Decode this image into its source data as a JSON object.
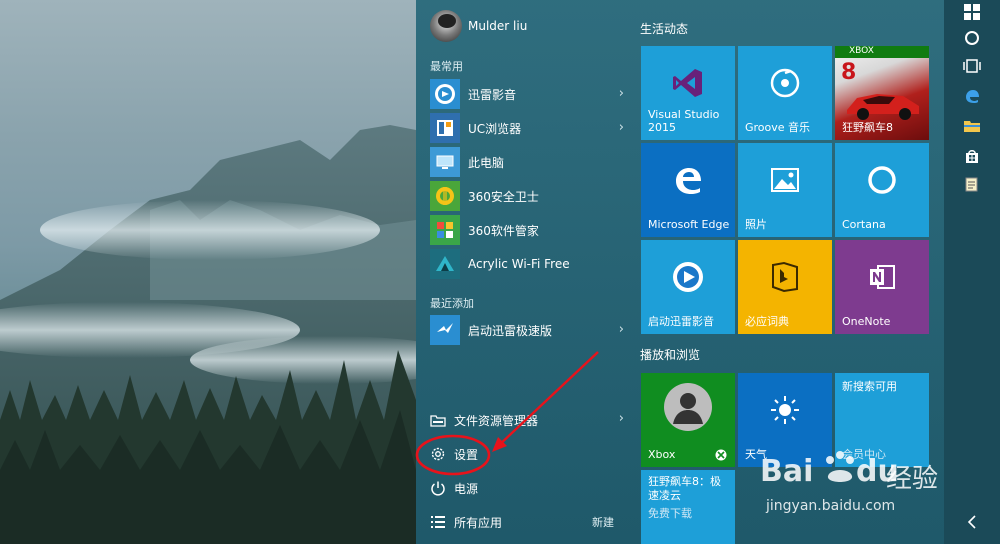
{
  "user": {
    "name": "Mulder liu"
  },
  "sections": {
    "most_used": "最常用",
    "recently_added": "最近添加"
  },
  "most_used_apps": [
    {
      "label": "迅雷影音",
      "has_arrow": true
    },
    {
      "label": "UC浏览器",
      "has_arrow": true
    },
    {
      "label": "此电脑",
      "has_arrow": false
    },
    {
      "label": "360安全卫士",
      "has_arrow": false
    },
    {
      "label": "360软件管家",
      "has_arrow": false
    },
    {
      "label": "Acrylic Wi-Fi Free",
      "has_arrow": false
    }
  ],
  "recent_apps": [
    {
      "label": "启动迅雷极速版",
      "has_arrow": true
    }
  ],
  "bottom": {
    "file_explorer": "文件资源管理器",
    "settings": "设置",
    "power": "电源",
    "all_apps": "所有应用",
    "new": "新建"
  },
  "tile_groups": {
    "life": "生活动态",
    "play": "播放和浏览"
  },
  "tiles": {
    "vs": "Visual Studio\n2015",
    "groove": "Groove 音乐",
    "racing": "狂野飙车8",
    "edge": "Microsoft Edge",
    "photos": "照片",
    "cortana": "Cortana",
    "xunlei": "启动迅雷影音",
    "biying": "必应词典",
    "onenote": "OneNote",
    "xbox": "Xbox",
    "weather": "天气",
    "newsearch": "新搜索可用",
    "racing_small": "狂野飙车8：极\n速凌云",
    "free_download": "免费下载",
    "member_center": "会员中心",
    "racing_logo_num": "8",
    "xbox_tag": "XBOX"
  },
  "watermark": {
    "brand": "Bai",
    "brand2": "du",
    "cn": "经验",
    "url": "jingyan.baidu.com"
  },
  "colors": {
    "menu_bg": "#246678",
    "tile_blue": "#1e9fd8",
    "tile_purple": "#7e3b8f",
    "tile_yellow": "#f4b400",
    "tile_green": "#108d20",
    "tile_darkblue": "#0b6fc2",
    "annotation_red": "#e8131b"
  },
  "icons": {
    "file_explorer": "folder-icon",
    "settings": "gear-icon",
    "power": "power-icon",
    "all_apps": "list-icon"
  }
}
